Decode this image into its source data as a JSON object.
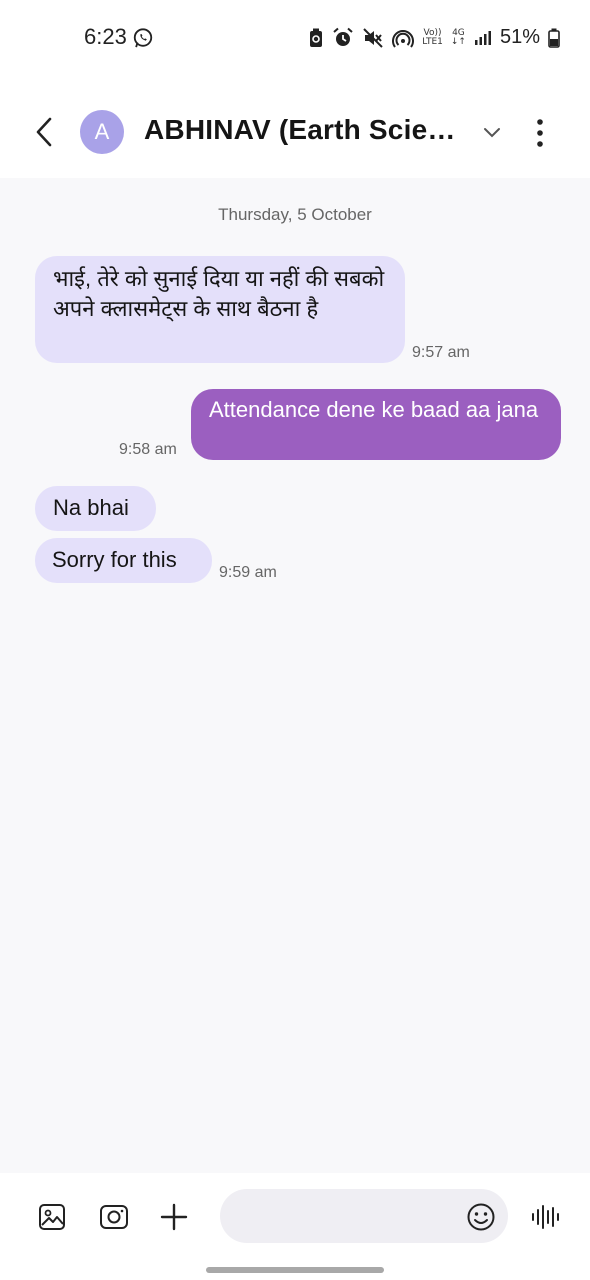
{
  "status_bar": {
    "time": "6:23",
    "network_top": "Vo)) ",
    "network_bottom": "LTE1",
    "data_type": "4G",
    "battery_percent": "51%"
  },
  "header": {
    "avatar_letter": "A",
    "contact_name": "ABHINAV (Earth Science)",
    "accent_color": "#a9a2e8"
  },
  "chat": {
    "date_separator": "Thursday, 5 October",
    "messages": [
      {
        "direction": "incoming",
        "text": "भाई, तेरे को सुनाई दिया या नहीं की सबको अपने क्लासमेट्स के साथ बैठना है",
        "time": "9:57 am"
      },
      {
        "direction": "outgoing",
        "text": "Attendance dene ke baad aa jana",
        "time": "9:58 am"
      },
      {
        "direction": "incoming",
        "text": "Na bhai",
        "time": ""
      },
      {
        "direction": "incoming",
        "text": "Sorry for this",
        "time": "9:59 am"
      }
    ],
    "incoming_color": "#e4e0fa",
    "outgoing_color": "#9b5fc0"
  },
  "composer": {
    "input_value": "",
    "input_placeholder": "",
    "icons": [
      "gallery-icon",
      "camera-icon",
      "plus-icon",
      "emoji-icon",
      "voice-icon"
    ]
  }
}
